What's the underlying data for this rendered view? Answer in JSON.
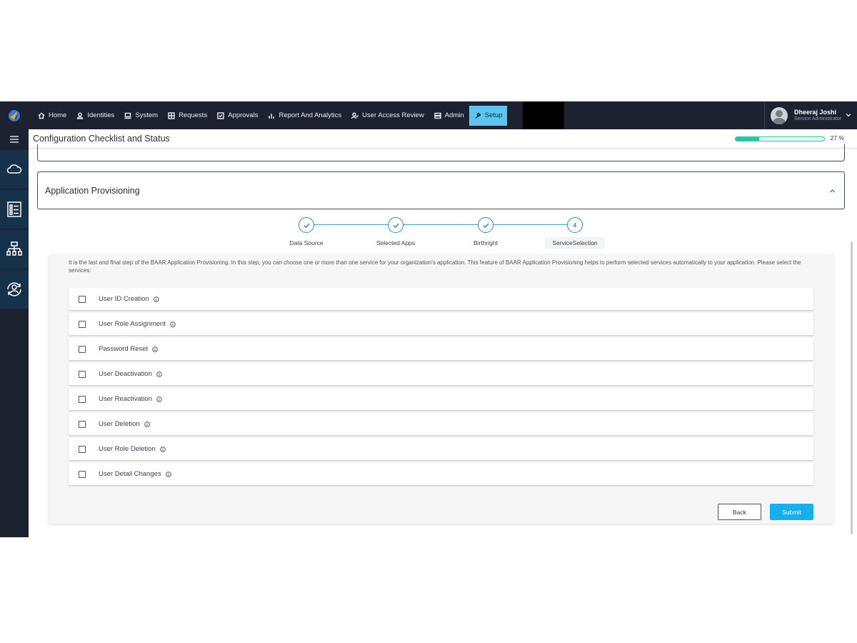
{
  "nav": {
    "items": [
      {
        "label": "Home",
        "icon": "home-icon"
      },
      {
        "label": "Identities",
        "icon": "user-icon"
      },
      {
        "label": "System",
        "icon": "laptop-icon"
      },
      {
        "label": "Requests",
        "icon": "grid-icon"
      },
      {
        "label": "Approvals",
        "icon": "checkbox-icon"
      },
      {
        "label": "Report And Analytics",
        "icon": "bar-chart-icon"
      },
      {
        "label": "User Access Review",
        "icon": "user-review-icon"
      },
      {
        "label": "Admin",
        "icon": "server-icon"
      },
      {
        "label": "Setup",
        "icon": "wrench-icon",
        "active": true
      }
    ],
    "accent_color": "#5bc6f0"
  },
  "user": {
    "name": "Dheeraj Joshi",
    "role": "Service Administrator"
  },
  "header": {
    "title": "Configuration Checklist and Status",
    "progress_label": "27 %",
    "progress_value": 0.27
  },
  "section": {
    "title": "Application Provisioning"
  },
  "stepper": {
    "steps": [
      {
        "label": "Data Source",
        "state": "complete"
      },
      {
        "label": "Selected Apps",
        "state": "complete"
      },
      {
        "label": "Birthright",
        "state": "complete"
      },
      {
        "label": "ServiceSelection",
        "state": "current",
        "number": "4"
      }
    ]
  },
  "services": {
    "intro": "It is the last and final step of the BAAR Application Provisioning. In this step, you can choose one or more than one service for your organization's application. This feature of BAAR Application Provisioning helps to perform selected services automatically to your application. Please select the services:",
    "items": [
      {
        "label": "User ID Creation"
      },
      {
        "label": "User Role Assignment"
      },
      {
        "label": "Password Reset"
      },
      {
        "label": "User Deactivation"
      },
      {
        "label": "User Reactivation"
      },
      {
        "label": "User Deletion"
      },
      {
        "label": "User Role Deletion"
      },
      {
        "label": "User Detail Changes"
      }
    ],
    "back_label": "Back",
    "submit_label": "Submit",
    "submit_color": "#14b0f0"
  }
}
